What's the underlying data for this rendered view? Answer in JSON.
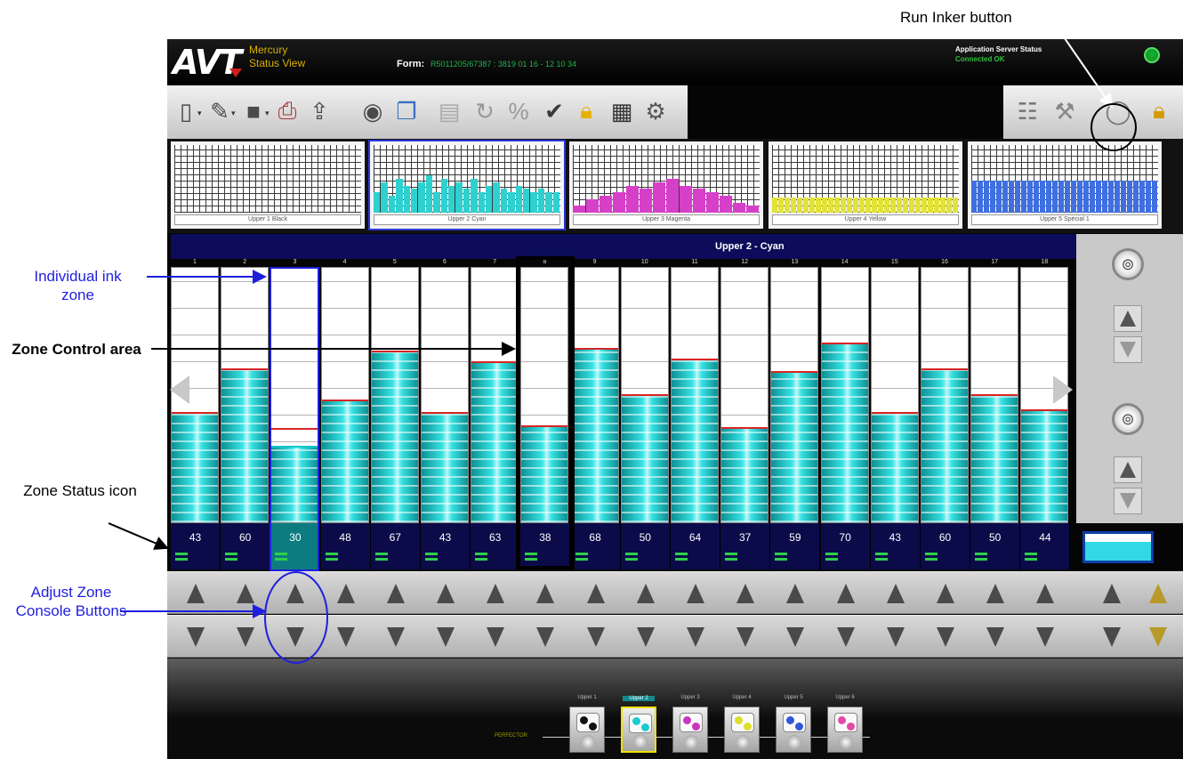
{
  "annotations": {
    "run_inker": "Run Inker button",
    "individual_zone": "Individual ink zone",
    "zone_control": "Zone Control area",
    "zone_status": "Zone Status icon",
    "adjust_buttons": "Adjust Zone Console Buttons"
  },
  "header": {
    "logo": "AVT",
    "app_line1": "Mercury",
    "app_line2": "Status View",
    "form_label": "Form:",
    "form_value": "R5011205/67387 : 3819 01 16 - 12 10 34",
    "server_status_label": "Application Server Status",
    "server_status_value": "Connected OK"
  },
  "toolbar_icons": [
    "new-document-icon",
    "open-folder-icon",
    "save-icon",
    "print-preview-icon",
    "export-icon",
    "percent-icon",
    "copy-icon",
    "paste-icon",
    "refresh-icon",
    "percent-settings-icon",
    "approve-icon",
    "lock-icon",
    "report-icon",
    "tools-icon",
    "mixer-icon",
    "wrench-icon",
    "run-inker-icon",
    "padlock-icon"
  ],
  "thumbnails": [
    {
      "label": "Upper 1 Black",
      "color": "#2a2a2a",
      "bars": []
    },
    {
      "label": "Upper 2 Cyan",
      "color": "#2fd0d0",
      "bars": [
        0.3,
        0.45,
        0.25,
        0.5,
        0.4,
        0.35,
        0.45,
        0.55,
        0.3,
        0.5,
        0.4,
        0.45,
        0.35,
        0.5,
        0.3,
        0.4,
        0.45,
        0.35,
        0.3,
        0.4,
        0.35,
        0.3,
        0.35,
        0.3,
        0.3
      ]
    },
    {
      "label": "Upper 3 Magenta",
      "color": "#d640c8",
      "bars": [
        0.1,
        0.2,
        0.25,
        0.3,
        0.4,
        0.35,
        0.45,
        0.5,
        0.4,
        0.35,
        0.3,
        0.25,
        0.15,
        0.1
      ]
    },
    {
      "label": "Upper 4 Yellow",
      "color": "#e2e23a",
      "bars": [
        0.22,
        0.22,
        0.22,
        0.22,
        0.22,
        0.22,
        0.22,
        0.22,
        0.22,
        0.22,
        0.22,
        0.22,
        0.22,
        0.22,
        0.22,
        0.22,
        0.22,
        0.22,
        0.22,
        0.22,
        0.22,
        0.22,
        0.22,
        0.22,
        0.22,
        0.22,
        0.22,
        0.22,
        0.22,
        0.22
      ]
    },
    {
      "label": "Upper 5 Special 1",
      "color": "#3f6fe0",
      "bars": [
        0.48,
        0.48,
        0.48,
        0.48,
        0.48,
        0.48,
        0.48,
        0.48,
        0.48,
        0.48,
        0.48,
        0.48,
        0.48,
        0.48,
        0.48,
        0.48,
        0.48,
        0.48,
        0.48,
        0.48,
        0.48,
        0.48,
        0.48,
        0.48,
        0.48,
        0.48,
        0.48,
        0.48,
        0.48,
        0.48
      ]
    }
  ],
  "ink_unit_title": "Upper 2 - Cyan",
  "zones": [
    {
      "num": "1",
      "value": 43,
      "level": 0.43,
      "target": 0.43
    },
    {
      "num": "2",
      "value": 60,
      "level": 0.6,
      "target": 0.6
    },
    {
      "num": "3",
      "value": 30,
      "level": 0.3,
      "target": 0.36,
      "highlight": true
    },
    {
      "num": "4",
      "value": 48,
      "level": 0.48,
      "target": 0.48
    },
    {
      "num": "5",
      "value": 67,
      "level": 0.67,
      "target": 0.67
    },
    {
      "num": "6",
      "value": 43,
      "level": 0.43,
      "target": 0.43
    },
    {
      "num": "7",
      "value": 63,
      "level": 0.63,
      "target": 0.63
    },
    {
      "num": "8",
      "value": 38,
      "level": 0.38,
      "target": 0.38
    },
    {
      "num": "9",
      "value": 68,
      "level": 0.68,
      "target": 0.68
    },
    {
      "num": "10",
      "value": 50,
      "level": 0.5,
      "target": 0.5
    },
    {
      "num": "11",
      "value": 64,
      "level": 0.64,
      "target": 0.64
    },
    {
      "num": "12",
      "value": 37,
      "level": 0.37,
      "target": 0.37
    },
    {
      "num": "13",
      "value": 59,
      "level": 0.59,
      "target": 0.59
    },
    {
      "num": "14",
      "value": 70,
      "level": 0.7,
      "target": 0.7
    },
    {
      "num": "15",
      "value": 43,
      "level": 0.43,
      "target": 0.43
    },
    {
      "num": "16",
      "value": 60,
      "level": 0.6,
      "target": 0.6
    },
    {
      "num": "17",
      "value": 50,
      "level": 0.5,
      "target": 0.5
    },
    {
      "num": "18",
      "value": 44,
      "level": 0.44,
      "target": 0.44
    }
  ],
  "ink_units": [
    {
      "label": "Upper 1",
      "dots": [
        "#111111",
        "#111111"
      ],
      "active": false
    },
    {
      "label": "Upper 2",
      "dots": [
        "#1fc9d0",
        "#1fc9d0"
      ],
      "active": true
    },
    {
      "label": "Upper 3",
      "dots": [
        "#c935bf",
        "#c935bf"
      ],
      "active": false
    },
    {
      "label": "Upper 4",
      "dots": [
        "#dede2a",
        "#dede2a"
      ],
      "active": false
    },
    {
      "label": "Upper 5",
      "dots": [
        "#3356d8",
        "#3356d8"
      ],
      "active": false
    },
    {
      "label": "Upper 6",
      "dots": [
        "#e04aa8",
        "#e04aa8"
      ],
      "active": false
    }
  ],
  "bottom_left_text": "PERFECTOR",
  "colors": {
    "accent_header": "#0c0c5a",
    "ink_cyan": "#14c4c6",
    "annotation_blue": "#1f1fdc",
    "target_line": "#d82424"
  }
}
